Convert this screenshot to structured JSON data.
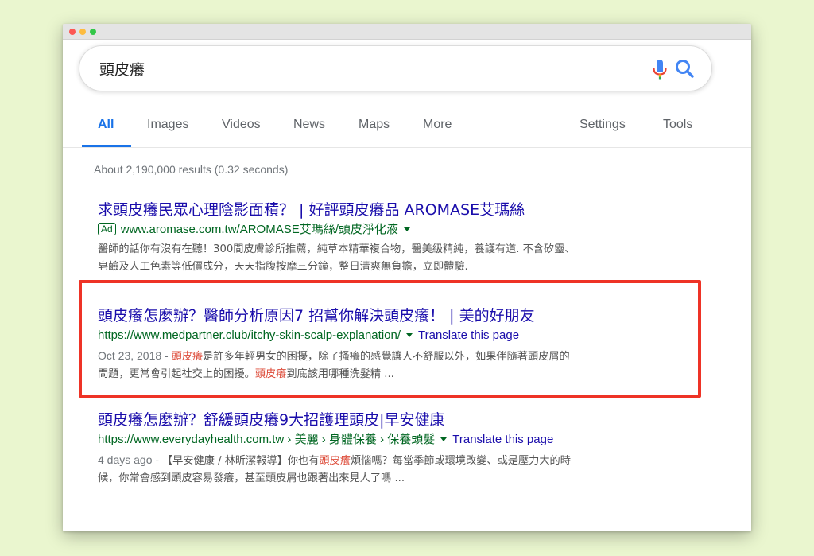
{
  "search": {
    "query": "頭皮癢"
  },
  "tabs": {
    "all": "All",
    "images": "Images",
    "videos": "Videos",
    "news": "News",
    "maps": "Maps",
    "more": "More",
    "settings": "Settings",
    "tools": "Tools"
  },
  "stats": "About 2,190,000 results (0.32 seconds)",
  "results": [
    {
      "title": "求頭皮癢民眾心理陰影面積？ | 好評頭皮癢品 AROMASE艾瑪絲",
      "ad_badge": "Ad",
      "url": "www.aromase.com.tw/AROMASE艾瑪絲/頭皮淨化液",
      "snippet_line1": "醫師的話你有沒有在聽！300間皮膚診所推薦，純草本精華複合物，醫美級精純，養護有道. 不含矽靈、",
      "snippet_line2": "皂鹼及人工色素等低價成分，天天指腹按摩三分鐘，整日清爽無負擔，立即體驗."
    },
    {
      "title": "頭皮癢怎麼辦？醫師分析原因7 招幫你解決頭皮癢！ | 美的好朋友",
      "url": "https://www.medpartner.club/itchy-skin-scalp-explanation/",
      "translate": "Translate this page",
      "date": "Oct 23, 2018 - ",
      "hl1": "頭皮癢",
      "snippet_a": "是許多年輕男女的困擾，除了搔癢的感覺讓人不舒服以外，如果伴隨著頭皮屑的",
      "snippet_b": "問題，更常會引起社交上的困擾。",
      "hl2": "頭皮癢",
      "snippet_c": "到底該用哪種洗髮精 ..."
    },
    {
      "title": "頭皮癢怎麼辦？舒緩頭皮癢9大招護理頭皮|早安健康",
      "url": "https://www.everydayhealth.com.tw › 美麗 › 身體保養 › 保養頭髮",
      "translate": "Translate this page",
      "date": "4 days ago - ",
      "snippet_a": "【早安健康 / 林昕潔報導】你也有",
      "hl1": "頭皮癢",
      "snippet_b": "煩惱嗎？每當季節或環境改變、或是壓力大的時",
      "snippet_c": "候，你常會感到頭皮容易發癢，甚至頭皮屑也跟著出來見人了嗎 ..."
    }
  ],
  "colors": {
    "link": "#1a0dab",
    "url": "#006621",
    "highlight": "#dd4b39",
    "accent": "#1a73e8",
    "annotation": "#ee3326"
  }
}
